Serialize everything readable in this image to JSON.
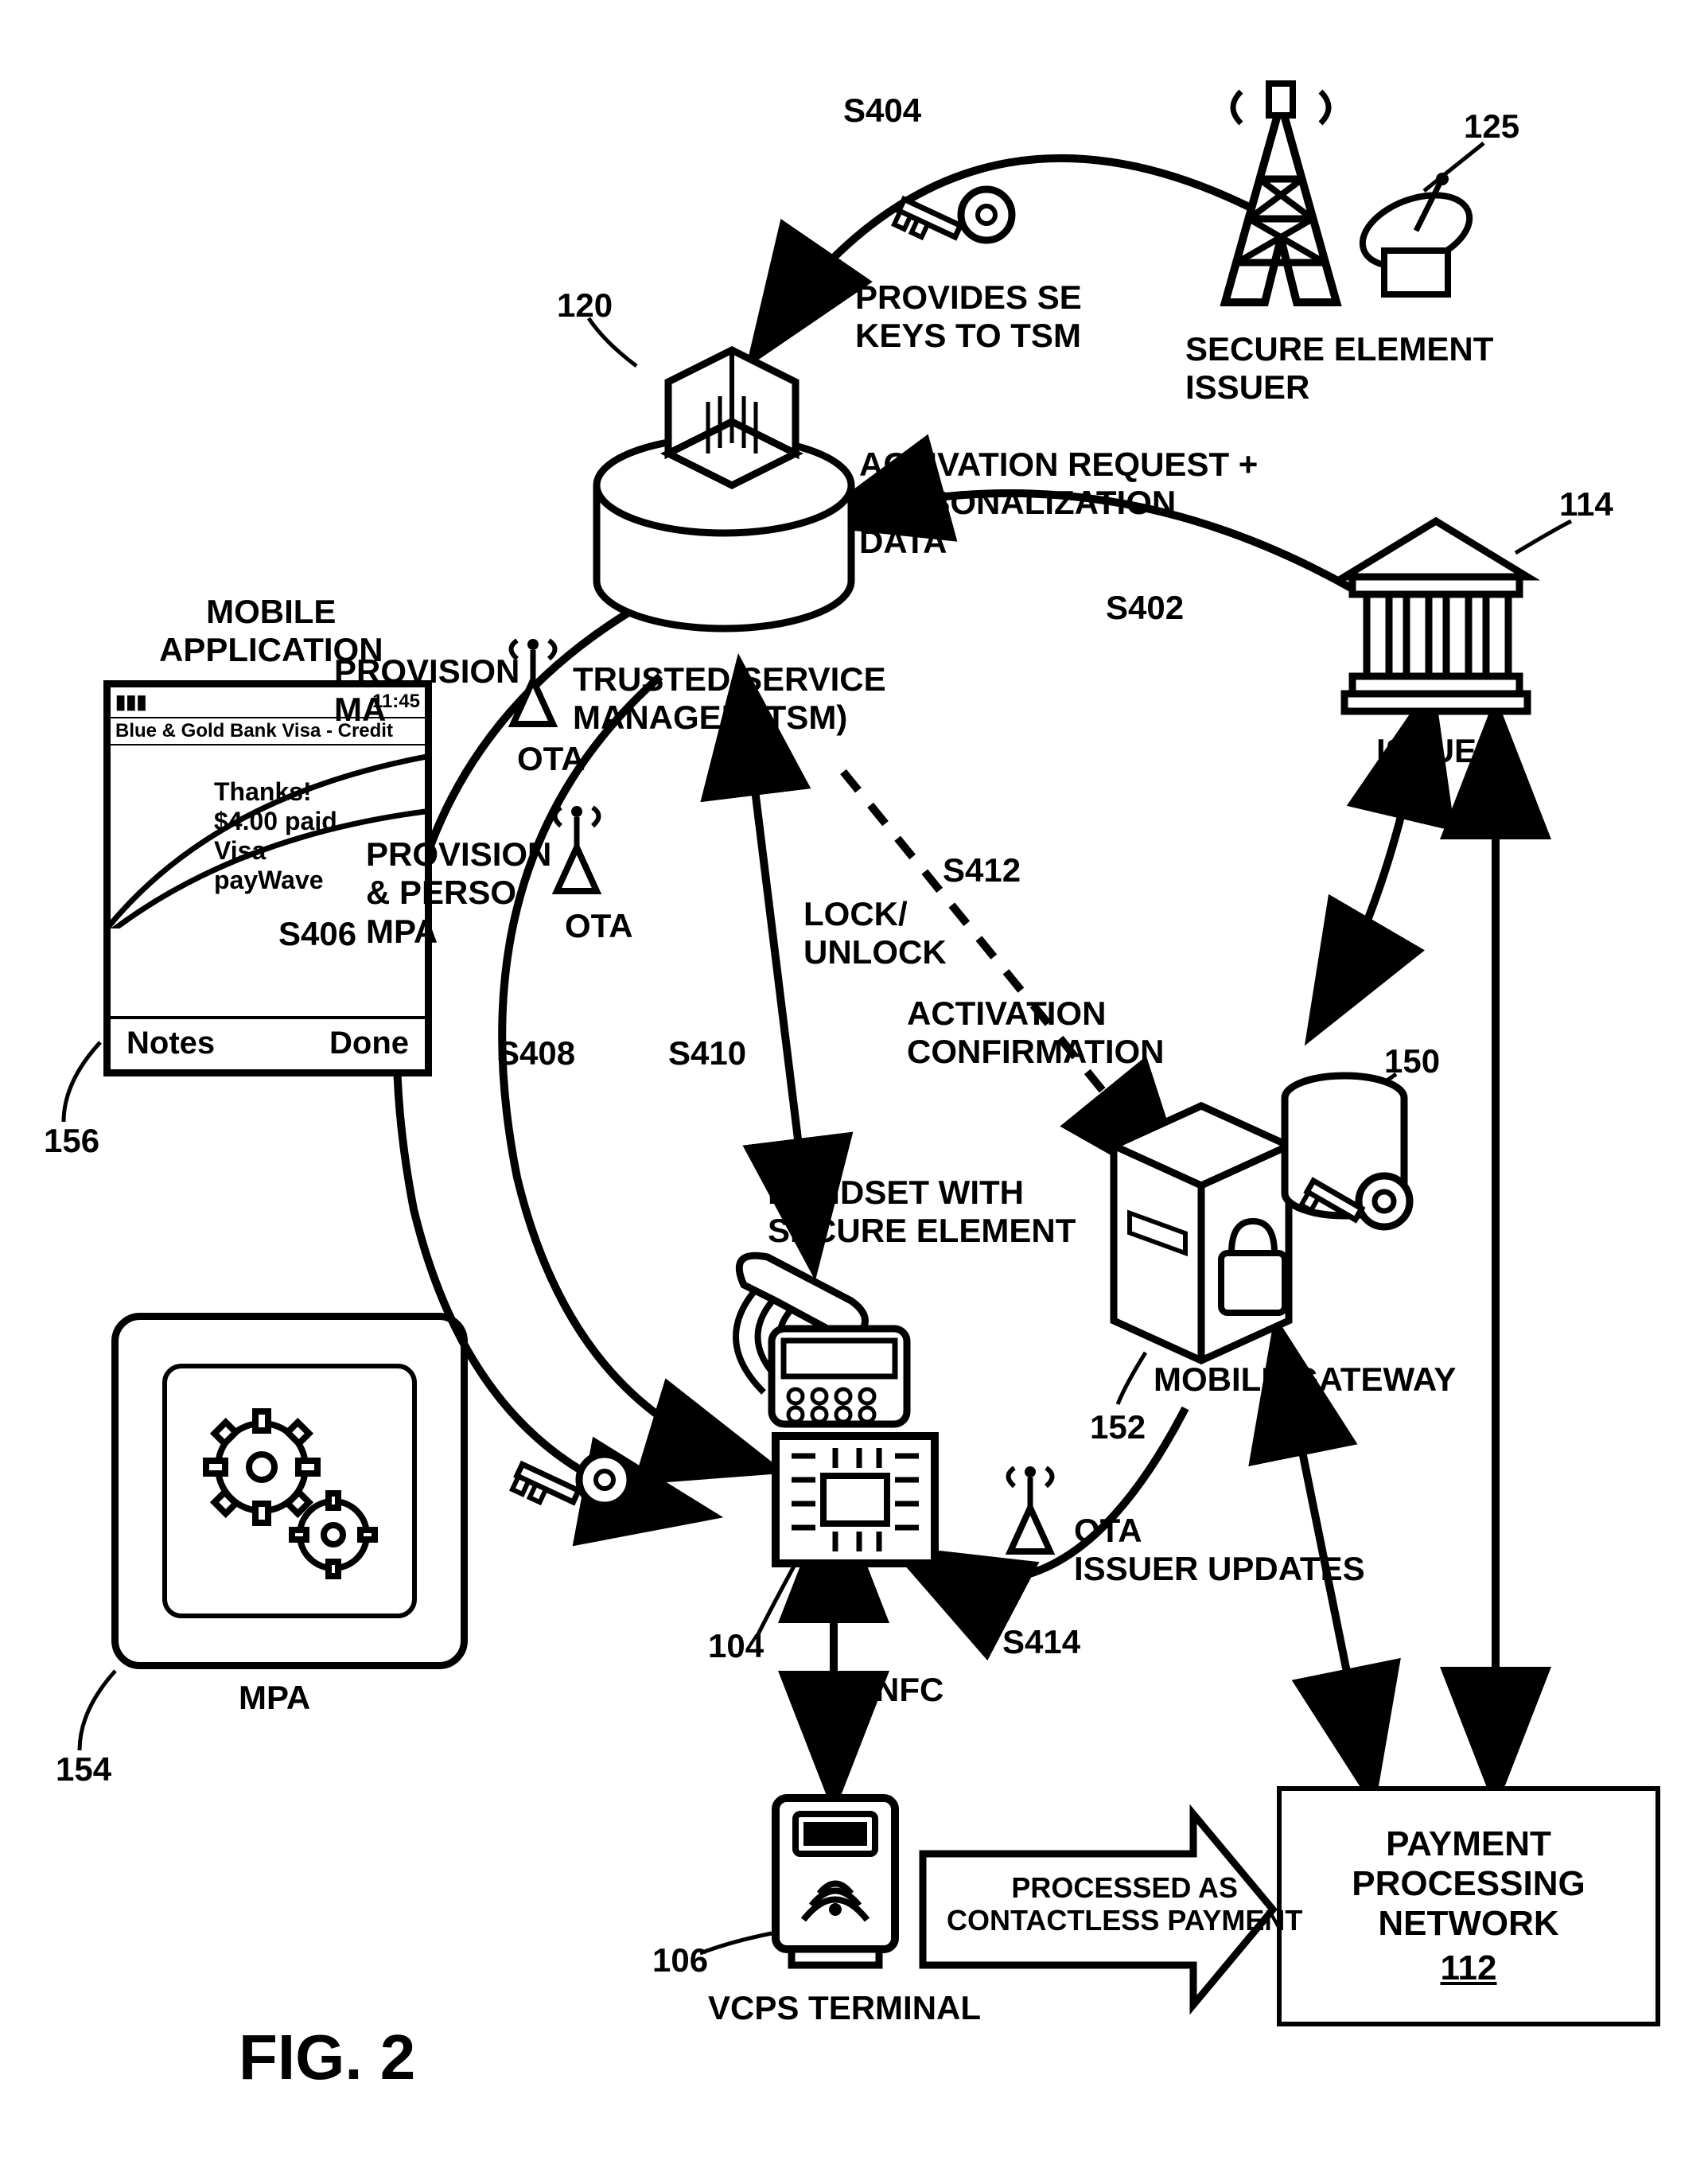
{
  "figure": "FIG. 2",
  "nodes": {
    "tsm": {
      "ref": "120",
      "label": "TRUSTED SERVICE\nMANAGER (TSM)"
    },
    "sei": {
      "ref": "125",
      "label": "SECURE ELEMENT\nISSUER"
    },
    "issuer": {
      "ref": "114",
      "label": "ISSUER"
    },
    "mobile_gateway": {
      "ref": "150",
      "ref2": "152",
      "label": "MOBILE GATEWAY"
    },
    "handset": {
      "ref": "104",
      "label": "HANDSET WITH\nSECURE ELEMENT"
    },
    "vcps_terminal": {
      "ref": "106",
      "label": "VCPS TERMINAL"
    },
    "ppn": {
      "ref": "112",
      "label": "PAYMENT\nPROCESSING\nNETWORK"
    },
    "mobile_app": {
      "ref": "156",
      "title": "MOBILE\nAPPLICATION",
      "statusbar_left": "▮▮▮",
      "time": "11:45",
      "card_line": "Blue & Gold Bank Visa - Credit",
      "main_text": "Thanks!\n$4.00 paid\nVisa\npayWave",
      "btn_left": "Notes",
      "btn_right": "Done"
    },
    "mpa": {
      "ref": "154",
      "label": "MPA"
    }
  },
  "ota": "OTA",
  "nfc": "NFC",
  "steps": {
    "s404": {
      "id": "S404",
      "label": "PROVIDES SE\nKEYS TO TSM"
    },
    "s402": {
      "id": "S402",
      "label": "ACTIVATION REQUEST +\nPERSONALIZATION\nDATA"
    },
    "s406": {
      "id": "S406",
      "label": "PROVISION\nMA"
    },
    "s408": {
      "id": "S408",
      "label": "PROVISION\n& PERSO\nMPA"
    },
    "s410": {
      "id": "S410",
      "label": "LOCK/\nUNLOCK"
    },
    "s412": {
      "id": "S412",
      "label": "ACTIVATION\nCONFIRMATION"
    },
    "s414": {
      "id": "S414",
      "label": "OTA\nISSUER UPDATES"
    },
    "contactless": "PROCESSED AS\nCONTACTLESS PAYMENT"
  }
}
